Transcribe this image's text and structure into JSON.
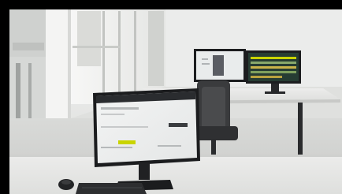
{
  "photo": {
    "frame_color": "#000000",
    "wall_color": "#e9eae9",
    "floor_color": "#d7d8d6",
    "desk_color": "#e6e6e4",
    "monitor_bezel_color": "#1b1c1e",
    "accent_color": "#c9d400"
  }
}
